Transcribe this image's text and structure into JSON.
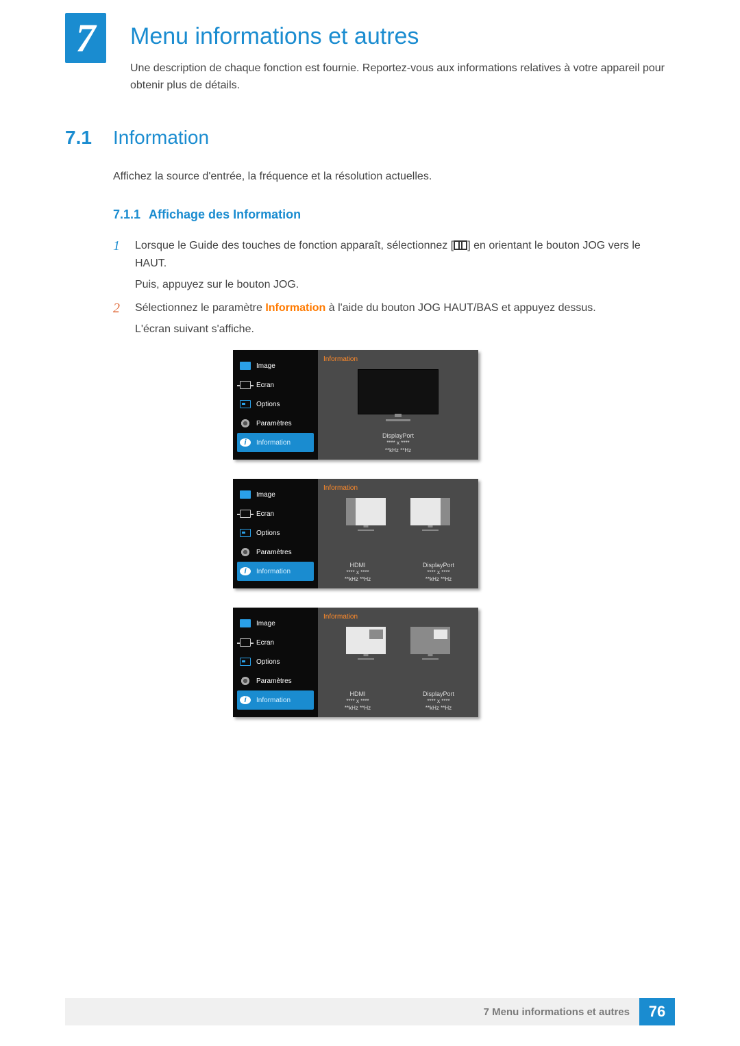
{
  "chapter": {
    "number": "7",
    "title": "Menu informations et autres",
    "intro": "Une description de chaque fonction est fournie. Reportez-vous aux informations relatives à votre appareil pour obtenir plus de détails."
  },
  "section": {
    "number": "7.1",
    "title": "Information",
    "body": "Affichez la source d'entrée, la fréquence et la résolution actuelles."
  },
  "subsection": {
    "number": "7.1.1",
    "title": "Affichage des Information"
  },
  "steps": {
    "s1a": "Lorsque le Guide des touches de fonction apparaît, sélectionnez [",
    "s1b": "] en orientant le bouton JOG vers le HAUT.",
    "s1c": "Puis, appuyez sur le bouton JOG.",
    "s2a": "Sélectionnez le paramètre ",
    "s2hl": "Information",
    "s2b": " à l'aide du bouton JOG HAUT/BAS et appuyez dessus.",
    "s2c": "L'écran suivant s'affiche."
  },
  "osd": {
    "menu": [
      "Image",
      "Ecran",
      "Options",
      "Paramètres",
      "Information"
    ],
    "panelTitle": "Information",
    "res": "**** x ****",
    "freq": "**kHz **Hz",
    "src_dp": "DisplayPort",
    "src_hdmi": "HDMI"
  },
  "footer": {
    "label": "7 Menu informations et autres",
    "page": "76"
  }
}
